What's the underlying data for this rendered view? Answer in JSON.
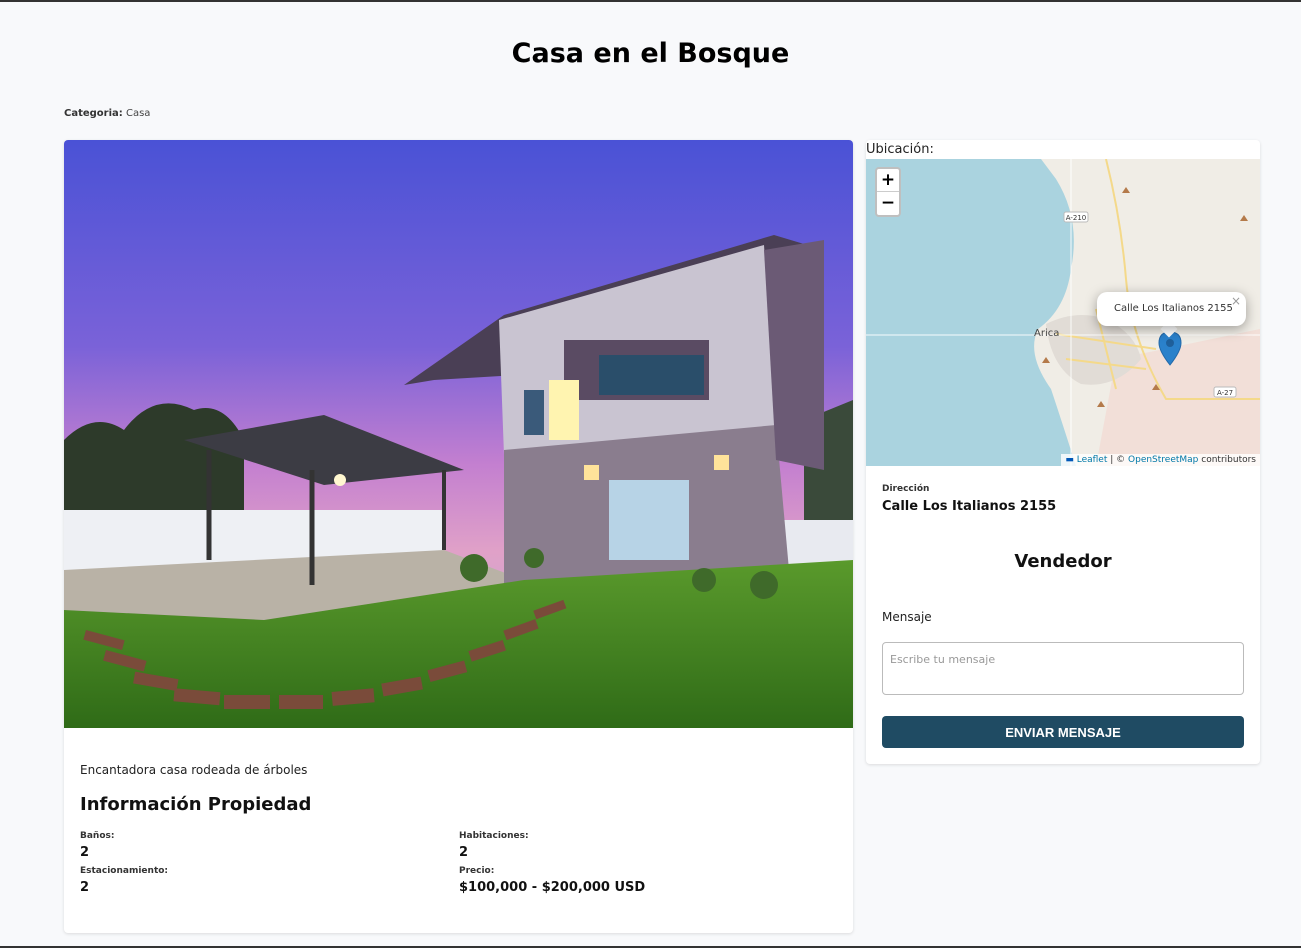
{
  "page": {
    "title": "Casa en el Bosque"
  },
  "category": {
    "label": "Categoria:",
    "value": "Casa"
  },
  "property": {
    "description": "Encantadora casa rodeada de árboles",
    "info_title": "Información Propiedad",
    "fields": [
      {
        "label": "Baños:",
        "value": "2"
      },
      {
        "label": "Habitaciones:",
        "value": "2"
      },
      {
        "label": "Estacionamiento:",
        "value": "2"
      },
      {
        "label": "Precio:",
        "value": "$100,000 - $200,000 USD"
      }
    ]
  },
  "location": {
    "label": "Ubicación:",
    "map": {
      "zoom_in": "+",
      "zoom_out": "−",
      "popup_text": "Calle Los Italianos 2155",
      "popup_close": "×",
      "city_label": "Arica",
      "road_labels": [
        "A-210",
        "A-27"
      ],
      "attribution_leaflet": "Leaflet",
      "attribution_sep": " | © ",
      "attribution_osm": "OpenStreetMap",
      "attribution_suffix": " contributors"
    },
    "address_label": "Dirección",
    "address_value": "Calle Los Italianos 2155"
  },
  "seller": {
    "title": "Vendedor",
    "message_label": "Mensaje",
    "message_placeholder": "Escribe tu mensaje",
    "send_label": "ENVIAR MENSAJE"
  },
  "colors": {
    "button": "#1f4b63",
    "page_bg": "#f8f9fb",
    "sea": "#aad3df",
    "marker": "#2a81cb"
  }
}
